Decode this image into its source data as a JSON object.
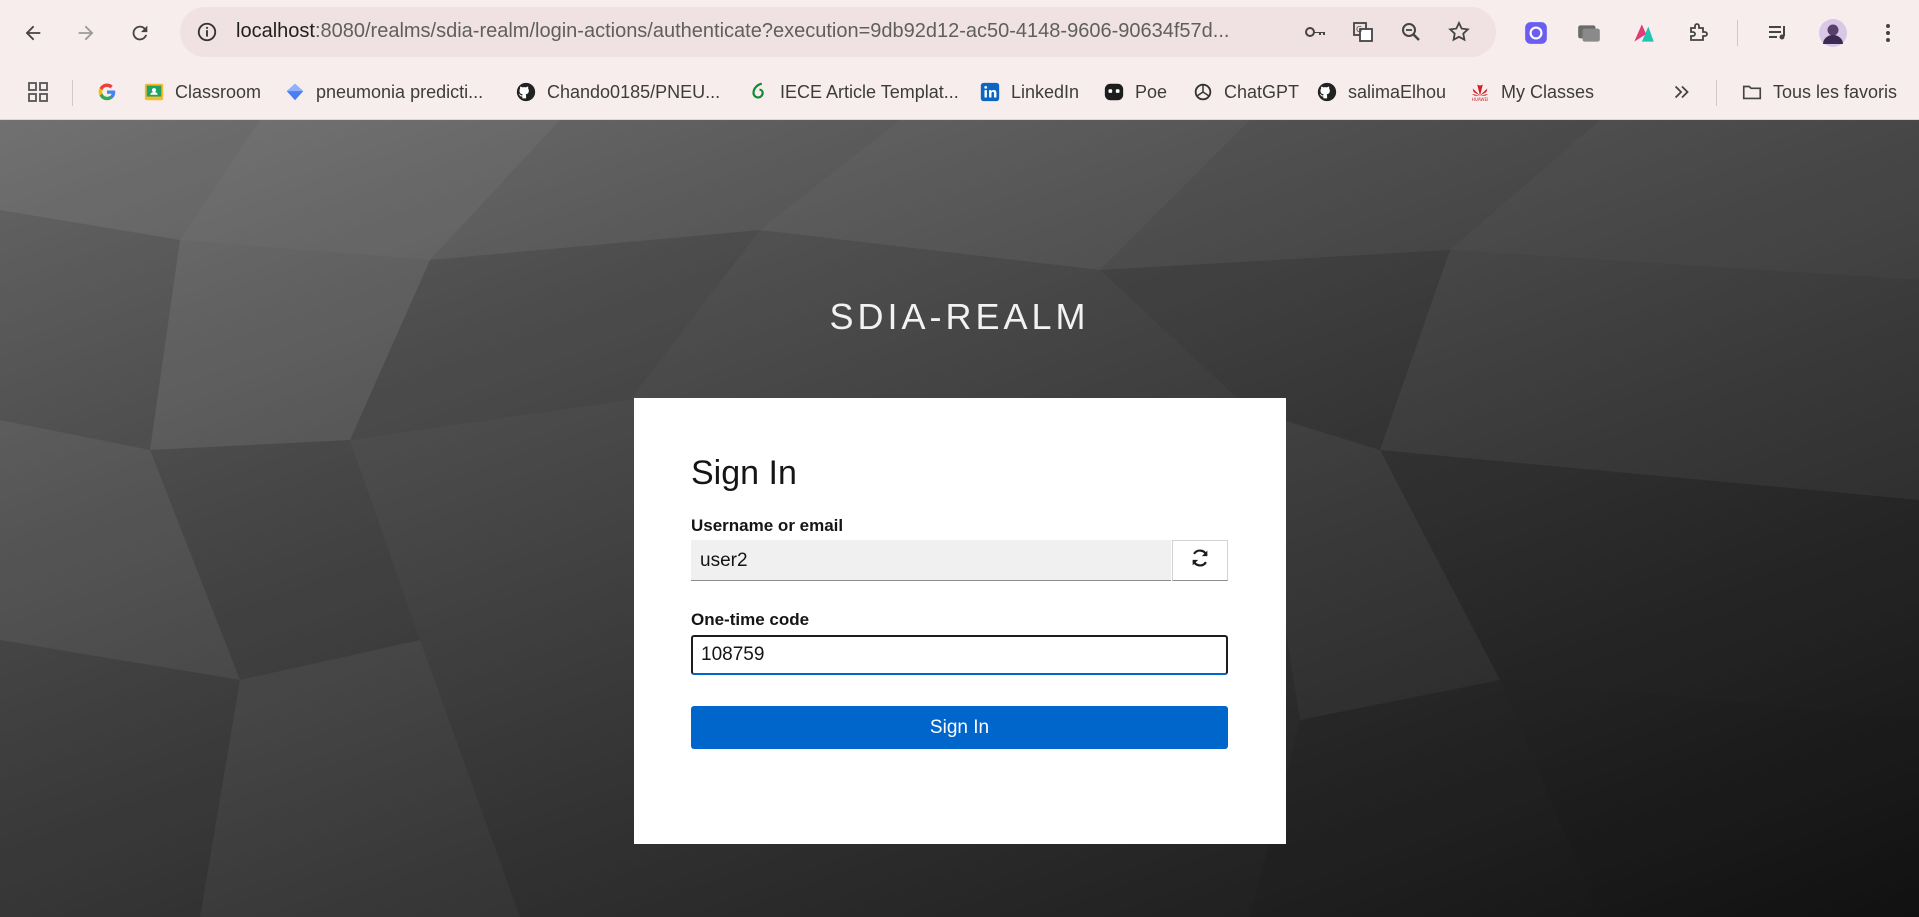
{
  "browser": {
    "url_host": "localhost",
    "url_rest": ":8080/realms/sdia-realm/login-actions/authenticate?execution=9db92d12-ac50-4148-9606-90634f57d...",
    "bookmarks": [
      {
        "label": "",
        "icon": "google-icon"
      },
      {
        "label": "Classroom",
        "icon": "classroom-icon"
      },
      {
        "label": "pneumonia predicti...",
        "icon": "gem-icon"
      },
      {
        "label": "Chando0185/PNEU...",
        "icon": "github-icon"
      },
      {
        "label": "IECE Article Templat...",
        "icon": "overleaf-icon"
      },
      {
        "label": "LinkedIn",
        "icon": "linkedin-icon"
      },
      {
        "label": "Poe",
        "icon": "poe-icon"
      },
      {
        "label": "ChatGPT",
        "icon": "chatgpt-icon"
      },
      {
        "label": "salimaElhou",
        "icon": "github-icon"
      },
      {
        "label": "My Classes",
        "icon": "huawei-icon"
      }
    ],
    "all_bookmarks_label": "Tous les favoris"
  },
  "page": {
    "realm_title": "SDIA-REALM",
    "heading": "Sign In",
    "username_label": "Username or email",
    "username_value": "user2",
    "otp_label": "One-time code",
    "otp_value": "108759",
    "submit_label": "Sign In"
  },
  "colors": {
    "primary": "#0066cc",
    "chrome_bg": "#f8eded"
  }
}
